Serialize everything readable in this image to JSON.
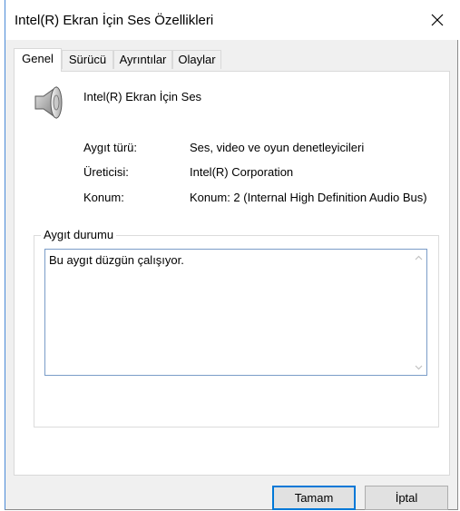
{
  "window": {
    "title": "Intel(R) Ekran İçin Ses Özellikleri",
    "close_glyph": "✕"
  },
  "tabs": [
    {
      "label": "Genel",
      "active": true
    },
    {
      "label": "Sürücü",
      "active": false
    },
    {
      "label": "Ayrıntılar",
      "active": false
    },
    {
      "label": "Olaylar",
      "active": false
    }
  ],
  "general": {
    "device_icon": "speaker-icon",
    "device_name": "Intel(R) Ekran İçin Ses",
    "properties": [
      {
        "label": "Aygıt türü:",
        "value": "Ses, video ve oyun denetleyicileri"
      },
      {
        "label": "Üreticisi:",
        "value": "Intel(R) Corporation"
      },
      {
        "label": "Konum:",
        "value": "Konum: 2 (Internal High Definition Audio Bus)"
      }
    ],
    "status_group_label": "Aygıt durumu",
    "status_text": "Bu aygıt düzgün çalışıyor."
  },
  "buttons": {
    "ok_label": "Tamam",
    "cancel_label": "İptal"
  },
  "colors": {
    "accent": "#0078d7",
    "window_border": "#4a8ad6"
  }
}
